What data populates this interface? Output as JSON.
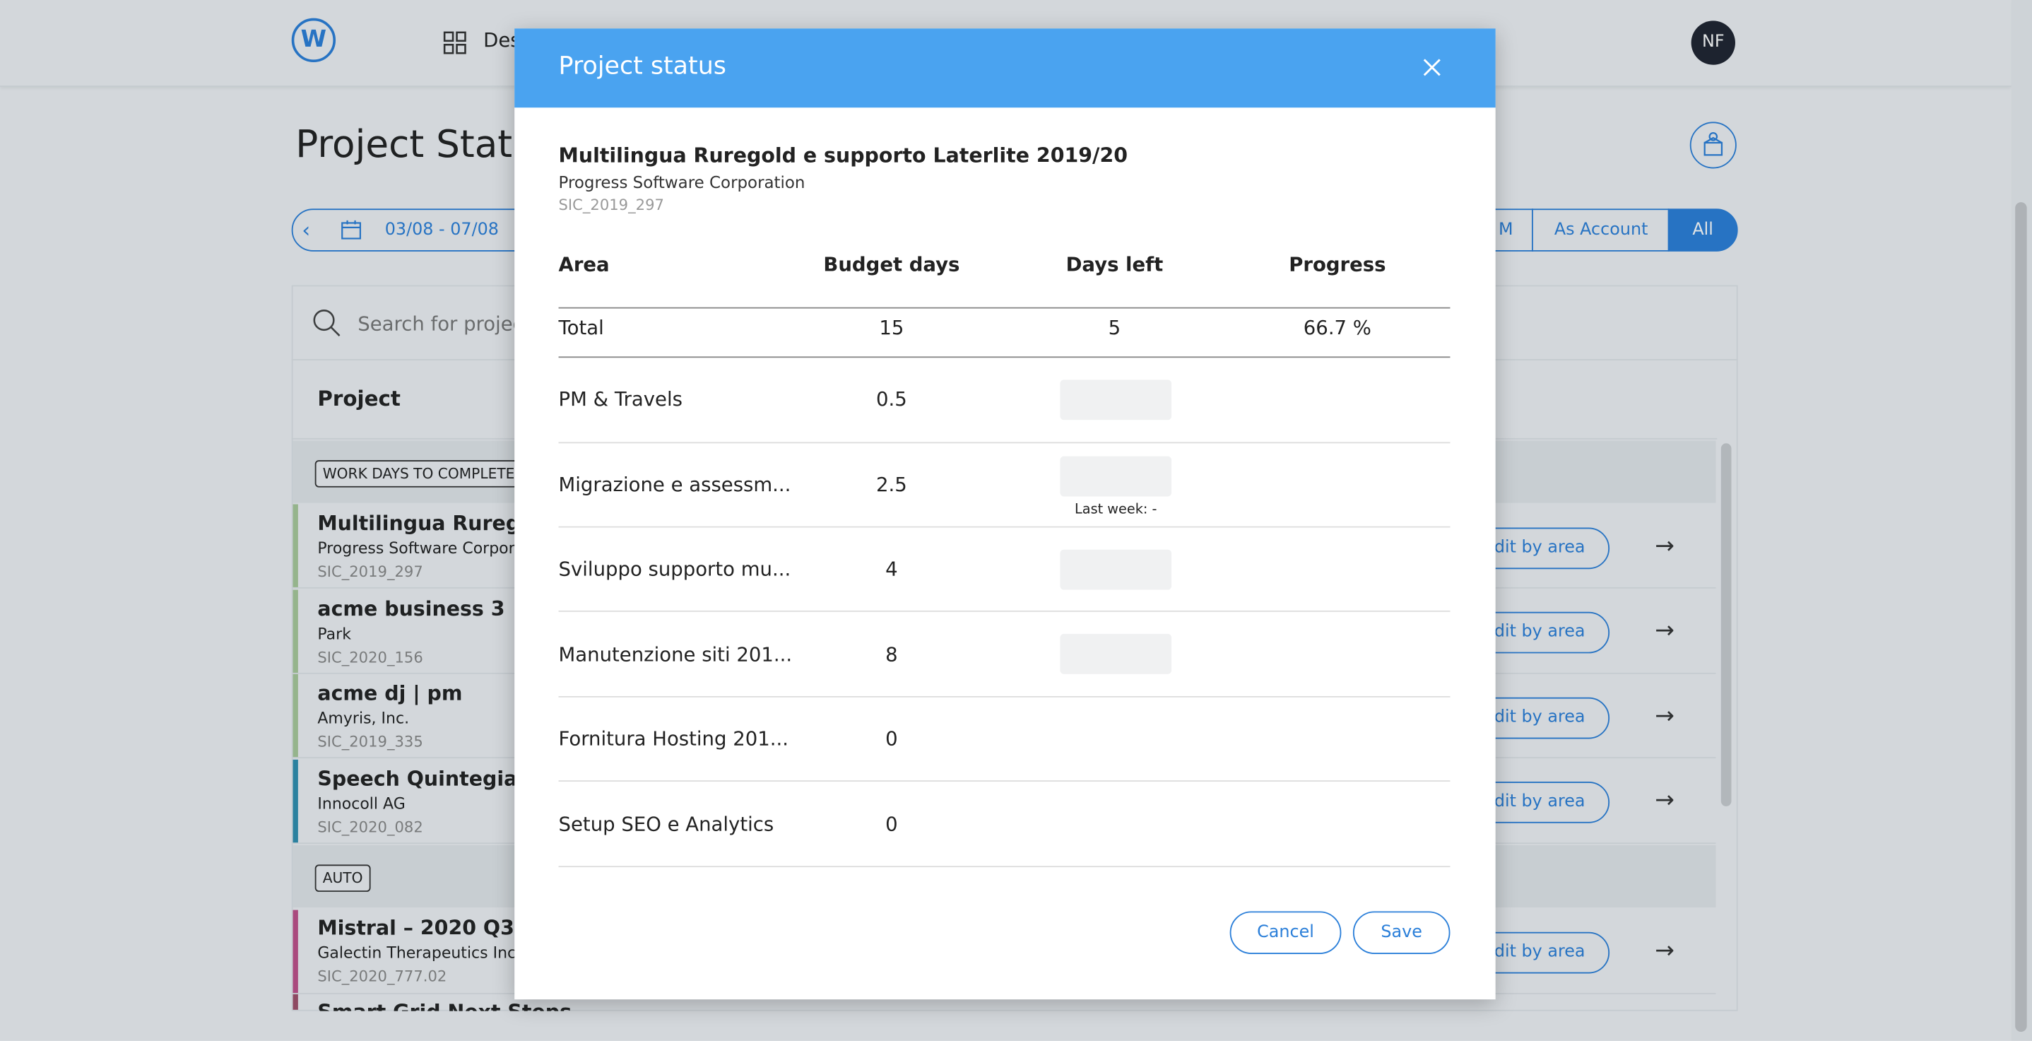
{
  "app": {
    "avatar_initials": "NF",
    "nav_label": "Des"
  },
  "page": {
    "title": "Project Status"
  },
  "filters": {
    "date_range": "03/08 - 07/08",
    "segments": [
      {
        "label": "M",
        "active": false
      },
      {
        "label": "As Account",
        "active": false
      },
      {
        "label": "All",
        "active": true
      }
    ]
  },
  "search": {
    "placeholder": "Search for projec"
  },
  "table": {
    "column_project": "Project",
    "groups": [
      {
        "tag": "WORK DAYS TO COMPLETE",
        "rows": [
          {
            "name": "Multilingua Ruregold",
            "client": "Progress Software Corpora",
            "code": "SIC_2019_297",
            "color": "#a8c99a",
            "action": "dit by area"
          },
          {
            "name": "acme business 3",
            "client": "Park",
            "code": "SIC_2020_156",
            "color": "#a8c99a",
            "action": "dit by area"
          },
          {
            "name": "acme dj | pm",
            "client": "Amyris, Inc.",
            "code": "SIC_2019_335",
            "color": "#a8c99a",
            "action": "dit by area"
          },
          {
            "name": "Speech Quintegia",
            "client": "Innocoll AG",
            "code": "SIC_2020_082",
            "color": "#2f8fb0",
            "action": "dit by area"
          }
        ]
      },
      {
        "tag": "AUTO",
        "rows": [
          {
            "name": "Mistral – 2020 Q3",
            "client": "Galectin Therapeutics Inc.",
            "code": "SIC_2020_777.02",
            "color": "#c0508a",
            "action": "dit by area"
          },
          {
            "name": "Smart Grid Next Steps",
            "client": "",
            "code": "",
            "color": "#a0506a",
            "action": ""
          }
        ]
      }
    ]
  },
  "modal": {
    "title": "Project status",
    "project_name": "Multilingua Ruregold e supporto Laterlite 2019/20",
    "client": "Progress Software Corporation",
    "code": "SIC_2019_297",
    "headers": {
      "area": "Area",
      "budget": "Budget days",
      "days_left": "Days left",
      "progress": "Progress"
    },
    "total": {
      "label": "Total",
      "budget": "15",
      "days_left": "5",
      "progress": "66.7 %"
    },
    "rows": [
      {
        "area": "PM & Travels",
        "budget": "0.5",
        "has_input": true,
        "last_week": ""
      },
      {
        "area": "Migrazione e assessm...",
        "budget": "2.5",
        "has_input": true,
        "last_week": "Last week: -"
      },
      {
        "area": "Sviluppo supporto mu...",
        "budget": "4",
        "has_input": true,
        "last_week": ""
      },
      {
        "area": "Manutenzione siti 201...",
        "budget": "8",
        "has_input": true,
        "last_week": ""
      },
      {
        "area": "Fornitura Hosting 201...",
        "budget": "0",
        "has_input": false,
        "last_week": ""
      },
      {
        "area": "Setup SEO e Analytics",
        "budget": "0",
        "has_input": false,
        "last_week": ""
      }
    ],
    "cancel_label": "Cancel",
    "save_label": "Save"
  }
}
